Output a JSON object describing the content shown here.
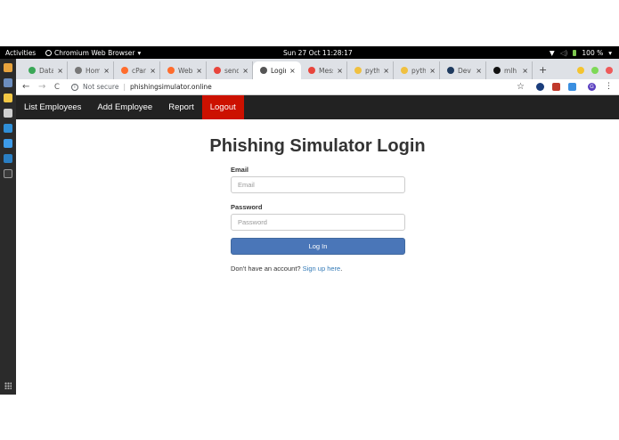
{
  "desktop": {
    "activities_label": "Activities",
    "app_name": "Chromium Web Browser",
    "app_menu_arrow": "▾",
    "clock": "Sun 27 Oct  11:28:17",
    "battery": "100 %",
    "tray_arrow": "▾"
  },
  "browser": {
    "tabs": [
      {
        "title": "Data",
        "favicon_color": "#3aa757"
      },
      {
        "title": "Home",
        "favicon_color": "#777777"
      },
      {
        "title": "cPanel",
        "favicon_color": "#ff6c2c"
      },
      {
        "title": "Web",
        "favicon_color": "#ff6c2c"
      },
      {
        "title": "send",
        "favicon_color": "#e8453c"
      },
      {
        "title": "Login",
        "favicon_color": "#555555"
      },
      {
        "title": "Mess",
        "favicon_color": "#e8453c"
      },
      {
        "title": "pyth",
        "favicon_color": "#f0c040"
      },
      {
        "title": "pyth",
        "favicon_color": "#f0c040"
      },
      {
        "title": "Dev",
        "favicon_color": "#1e3a5f"
      },
      {
        "title": "mlh",
        "favicon_color": "#111111"
      }
    ],
    "tab_close": "×",
    "new_tab": "+",
    "back": "←",
    "forward": "→",
    "reload": "C",
    "security_label": "Not secure",
    "url": "phishingsimulator.online",
    "star": "☆",
    "menu": "⋮",
    "avatar_letter": "G"
  },
  "site": {
    "nav": [
      {
        "label": "List Employees"
      },
      {
        "label": "Add Employee"
      },
      {
        "label": "Report"
      },
      {
        "label": "Logout"
      }
    ],
    "title": "Phishing Simulator Login",
    "email_label": "Email",
    "email_placeholder": "Email",
    "email_value": "",
    "password_label": "Password",
    "password_placeholder": "Password",
    "password_value": "",
    "login_button": "Log In",
    "signup_text": "Don't have an account?",
    "signup_link": "Sign up here",
    "signup_period": "."
  },
  "colors": {
    "navbar_bg": "#222222",
    "logout_active": "#cc1100",
    "primary_button": "#4a76b8",
    "link": "#337ab7"
  }
}
